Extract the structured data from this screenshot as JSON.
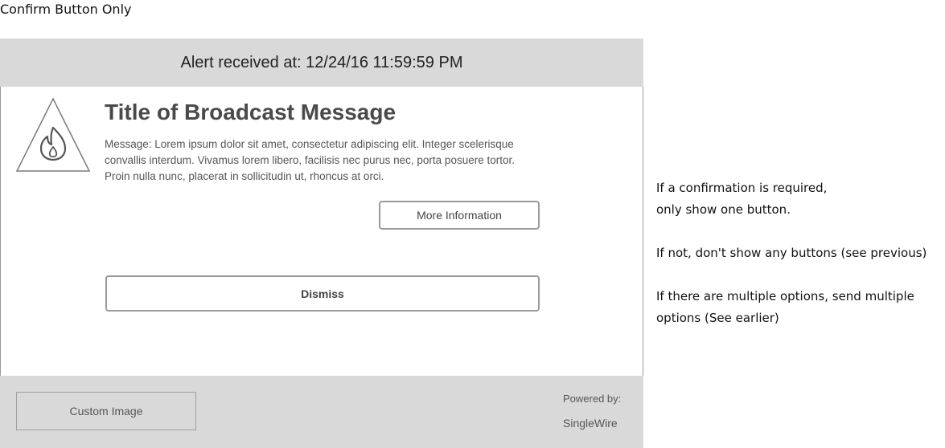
{
  "page": {
    "label": "Confirm Button Only"
  },
  "alert": {
    "header": "Alert received at: 12/24/16 11:59:59 PM",
    "icon": "fire-hazard-icon",
    "title": "Title of Broadcast Message",
    "message": "Message: Lorem ipsum dolor sit amet, consectetur adipiscing elit. Integer scelerisque convallis interdum. Vivamus lorem libero, facilisis nec purus nec, porta posuere tortor. Proin nulla nunc, placerat in sollicitudin ut, rhoncus at orci.",
    "more_info_label": "More Information",
    "dismiss_label": "Dismiss",
    "footer": {
      "custom_image_label": "Custom Image",
      "powered_by_label": "Powered by:",
      "powered_by_brand": "SingleWire"
    }
  },
  "notes": {
    "line1": "If a confirmation is required,",
    "line2": "only show one button.",
    "line3": "If not, don't show any buttons (see previous)",
    "line4": "If there are multiple options, send multiple",
    "line5": "options (See earlier)"
  },
  "colors": {
    "header_bg": "#d9d9d9",
    "footer_bg": "#d9d9d9",
    "border": "#9a9a9a",
    "title_text": "#4a4a4a"
  }
}
